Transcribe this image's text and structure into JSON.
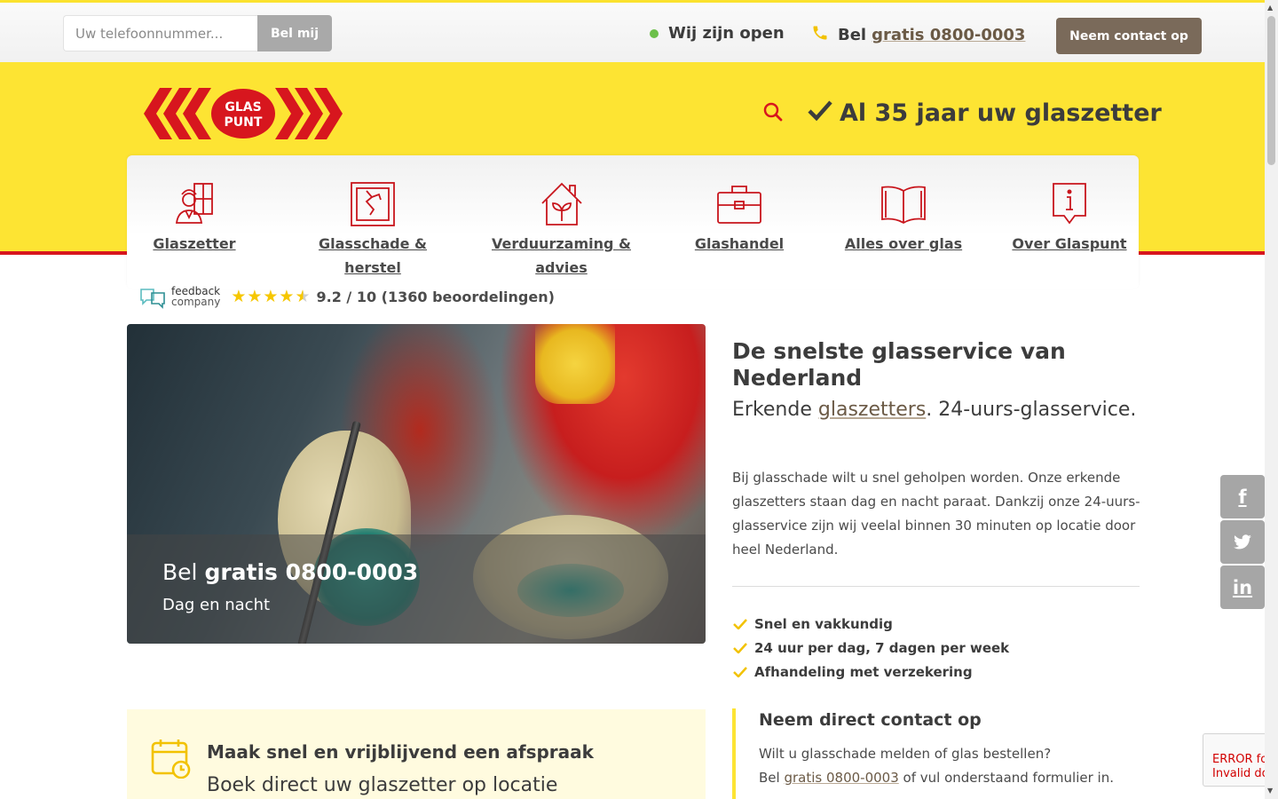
{
  "topbar": {
    "phone_placeholder": "Uw telefoonnummer...",
    "call_me_label": "Bel mij",
    "open_status": "Wij zijn open",
    "call_prefix": "Bel",
    "call_number": "gratis 0800-0003",
    "contact_label": "Neem contact op"
  },
  "header": {
    "logo_text_line1": "GLAS",
    "logo_text_line2": "PUNT",
    "tagline": "Al 35 jaar uw glaszetter"
  },
  "nav": {
    "items": [
      {
        "label": "Glaszetter",
        "icon": "glazier-icon"
      },
      {
        "label": "Glasschade & herstel",
        "icon": "broken-glass-icon"
      },
      {
        "label": "Verduurzaming & advies",
        "icon": "green-house-icon"
      },
      {
        "label": "Glashandel",
        "icon": "briefcase-icon"
      },
      {
        "label": "Alles over glas",
        "icon": "book-icon"
      },
      {
        "label": "Over Glaspunt",
        "icon": "info-icon"
      }
    ]
  },
  "rating": {
    "brand_line1": "feedback",
    "brand_line2": "company",
    "stars": 4.5,
    "text": "9.2 / 10 (1360 beoordelingen)"
  },
  "hero": {
    "call_prefix": "Bel",
    "call_number": "gratis 0800-0003",
    "subline": "Dag en nacht"
  },
  "intro": {
    "title": "De snelste glasservice van Nederland",
    "sub_prefix": "Erkende",
    "sub_link": "glaszetters",
    "sub_suffix": ". 24-uurs-glasservice.",
    "body": "Bij glasschade wilt u snel geholpen worden. Onze erkende glaszetters staan dag en nacht paraat. Dankzij onze 24-uurs-glasservice zijn wij veelal binnen 30 minuten op locatie door heel Nederland."
  },
  "usps": [
    "Snel en vakkundig",
    "24 uur per dag, 7 dagen per week",
    "Afhandeling met verzekering"
  ],
  "contact_box": {
    "title": "Neem direct contact op",
    "line1": "Wilt u glasschade melden of glas bestellen?",
    "line2_prefix": "Bel",
    "line2_link": "gratis 0800-0003",
    "line2_suffix": "of vul onderstaand formulier in."
  },
  "appointment": {
    "title": "Maak snel en vrijblijvend een afspraak",
    "subtitle": "Boek direct uw glaszetter op locatie"
  },
  "social": {
    "facebook": "f",
    "twitter": "twitter-icon",
    "linkedin": "in"
  },
  "recaptcha": {
    "line1": "ERROR fo",
    "line2": "Invalid do"
  },
  "colors": {
    "brand_yellow": "#fde433",
    "brand_red": "#d7161e",
    "accent_brown": "#7a6a5a"
  }
}
